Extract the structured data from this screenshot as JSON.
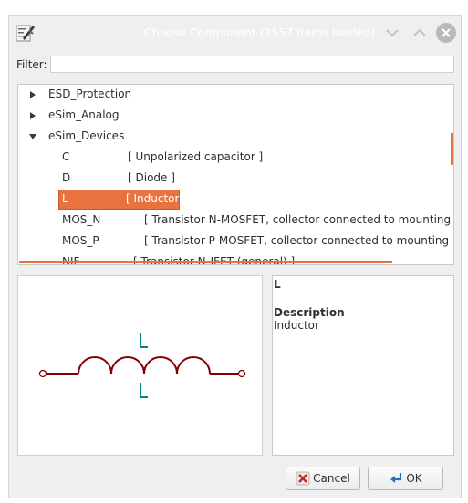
{
  "window": {
    "title": "Choose Component (2557 items loaded)"
  },
  "filter": {
    "label": "Filter:",
    "value": ""
  },
  "tree": {
    "libraries": [
      {
        "label": "ESD_Protection",
        "expanded": false
      },
      {
        "label": "eSim_Analog",
        "expanded": false
      },
      {
        "label": "eSim_Devices",
        "expanded": true
      }
    ],
    "components": [
      {
        "name": "C",
        "desc": "[ Unpolarized capacitor ]"
      },
      {
        "name": "D",
        "desc": "[ Diode ]"
      },
      {
        "name": "L",
        "desc": "[ Inductor ]",
        "selected": true
      },
      {
        "name": "MOS_N",
        "desc": "[ Transistor N-MOSFET, collector connected to mounting plane ]"
      },
      {
        "name": "MOS_P",
        "desc": "[ Transistor P-MOSFET, collector connected to mounting plane ]"
      },
      {
        "name": "NJF",
        "desc": "[ Transistor N-JFET (general) ]"
      }
    ]
  },
  "info": {
    "name": "L",
    "description_heading": "Description",
    "description": "Inductor"
  },
  "buttons": {
    "cancel": "Cancel",
    "ok": "OK"
  },
  "colors": {
    "accent": "#e8733f",
    "wire": "#840000",
    "reference": "#008484"
  },
  "icons": {
    "app": "kicad-app-icon",
    "minimize": "chevron-down-icon",
    "maximize": "chevron-up-icon",
    "close": "close-icon",
    "cancel": "cancel-x-icon",
    "ok": "ok-arrow-icon"
  }
}
